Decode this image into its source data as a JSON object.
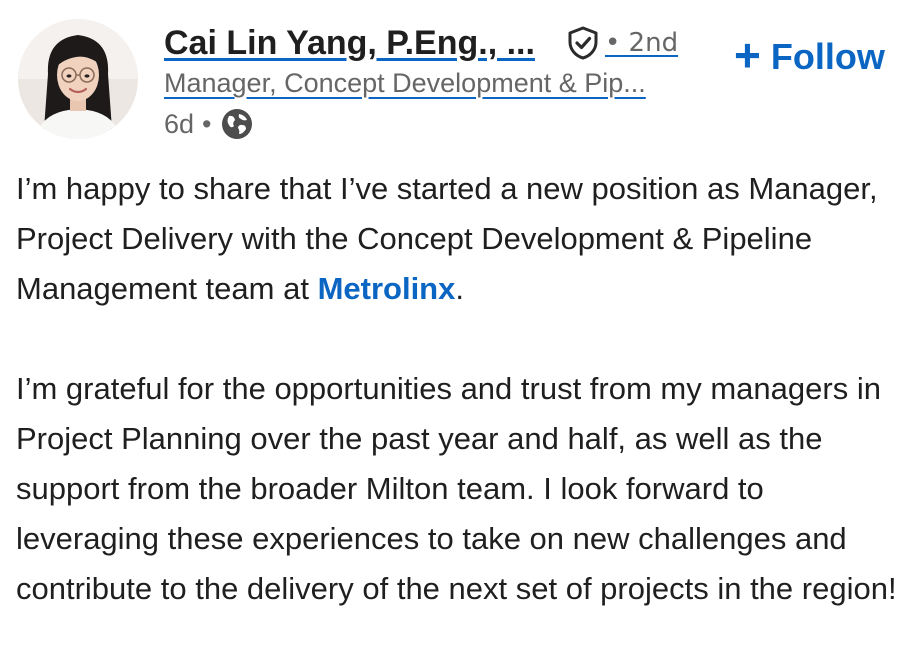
{
  "author": {
    "name": "Cai Lin Yang, P.Eng., ...",
    "connection_degree": "• 2nd",
    "headline": "Manager, Concept Development & Pip...",
    "verified_icon": "shield-check-icon",
    "avatar_icon": "profile-photo"
  },
  "post_meta": {
    "age": "6d",
    "separator": "•",
    "visibility_icon": "globe-icon"
  },
  "follow_button": {
    "icon": "plus-icon",
    "plus": "+",
    "label": "Follow"
  },
  "post": {
    "para1_before": "I’m happy to share that I’ve started a new position as Manager, Project Delivery with the Concept Development & Pipeline Management team at ",
    "para1_mention": "Metrolinx",
    "para1_after": ".",
    "para2": "I’m grateful for the opportunities and trust from my managers in Project Planning over the past year and half, as well as the support from the broader Milton team. I look forward to leveraging these experiences to take on new challenges and contribute to the delivery of the next set of projects in the region!"
  },
  "colors": {
    "link_blue": "#0a66c2",
    "text_primary": "#1f1f1f",
    "text_secondary": "#666666"
  }
}
